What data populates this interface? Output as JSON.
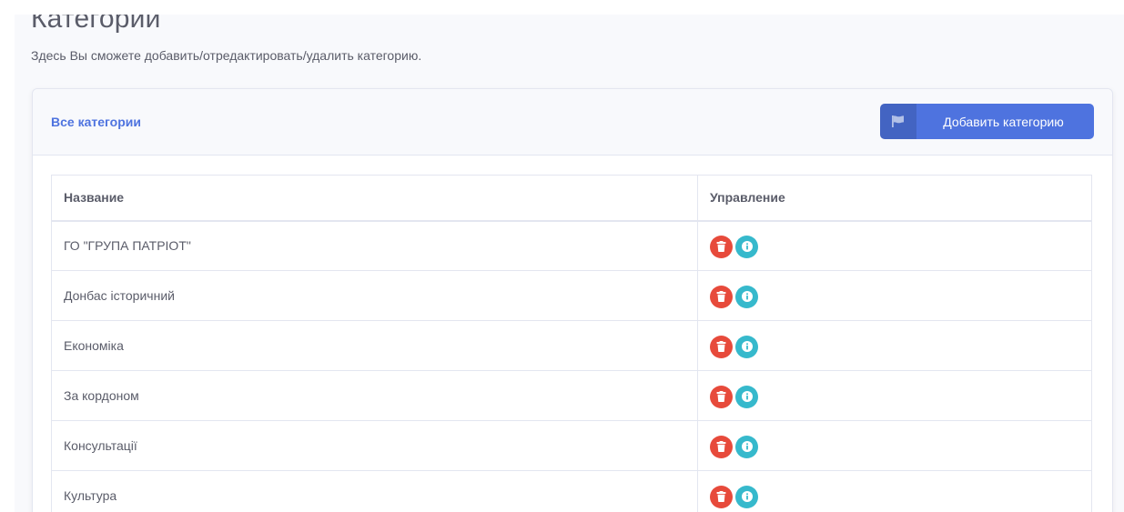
{
  "page": {
    "title": "Категории",
    "subtitle": "Здесь Вы сможете добавить/отредактировать/удалить категорию."
  },
  "card": {
    "title": "Все категории",
    "add_button_label": "Добавить категорию",
    "add_button_icon": "flag-icon"
  },
  "table": {
    "columns": [
      "Название",
      "Управление"
    ],
    "rows": [
      {
        "name": "ГО \"ГРУПА ПАТРІОТ\""
      },
      {
        "name": "Донбас історичний"
      },
      {
        "name": "Економіка"
      },
      {
        "name": "За кордоном"
      },
      {
        "name": "Консультації"
      },
      {
        "name": "Культура"
      }
    ],
    "actions": {
      "delete_icon": "trash-icon",
      "info_icon": "info-icon"
    }
  },
  "colors": {
    "primary": "#4e73df",
    "danger": "#e74a3b",
    "info": "#36b9cc",
    "text": "#5a5c69",
    "background": "#f8f9fc"
  }
}
